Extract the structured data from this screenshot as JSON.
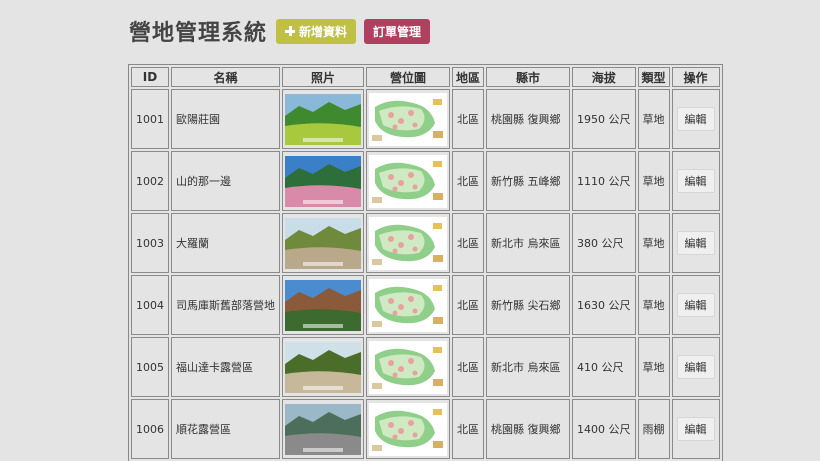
{
  "header": {
    "title": "營地管理系統",
    "add_label": "新增資料",
    "order_label": "訂單管理"
  },
  "columns": [
    "ID",
    "名稱",
    "照片",
    "營位圖",
    "地區",
    "縣市",
    "海拔",
    "類型",
    "操作"
  ],
  "edit_label": "編輯",
  "rows": [
    {
      "id": "1001",
      "name": "歐陽莊園",
      "region": "北區",
      "county": "桃園縣 復興鄉",
      "altitude": "1950 公尺",
      "type": "草地"
    },
    {
      "id": "1002",
      "name": "山的那一邊",
      "region": "北區",
      "county": "新竹縣 五峰鄉",
      "altitude": "1110 公尺",
      "type": "草地"
    },
    {
      "id": "1003",
      "name": "大羅蘭",
      "region": "北區",
      "county": "新北市 烏來區",
      "altitude": "380 公尺",
      "type": "草地"
    },
    {
      "id": "1004",
      "name": "司馬庫斯舊部落營地",
      "region": "北區",
      "county": "新竹縣 尖石鄉",
      "altitude": "1630 公尺",
      "type": "草地"
    },
    {
      "id": "1005",
      "name": "福山達卡露營區",
      "region": "北區",
      "county": "新北市 烏來區",
      "altitude": "410 公尺",
      "type": "草地"
    },
    {
      "id": "1006",
      "name": "順花露營區",
      "region": "北區",
      "county": "桃園縣 復興鄉",
      "altitude": "1400 公尺",
      "type": "雨棚"
    }
  ],
  "photos": [
    {
      "sky": "#8ab8d8",
      "mid": "#3f8a2e",
      "ground": "#a8c83e"
    },
    {
      "sky": "#3a7fc8",
      "mid": "#2d6e3a",
      "ground": "#d98aa8"
    },
    {
      "sky": "#c9dde8",
      "mid": "#6f8a3a",
      "ground": "#b9a88a"
    },
    {
      "sky": "#4b8bd0",
      "mid": "#8a5a3a",
      "ground": "#3d6a2e"
    },
    {
      "sky": "#cfe0e8",
      "mid": "#4a6e2a",
      "ground": "#c8b89a"
    },
    {
      "sky": "#9ab8c8",
      "mid": "#4d6e5a",
      "ground": "#8a8a8a"
    }
  ]
}
